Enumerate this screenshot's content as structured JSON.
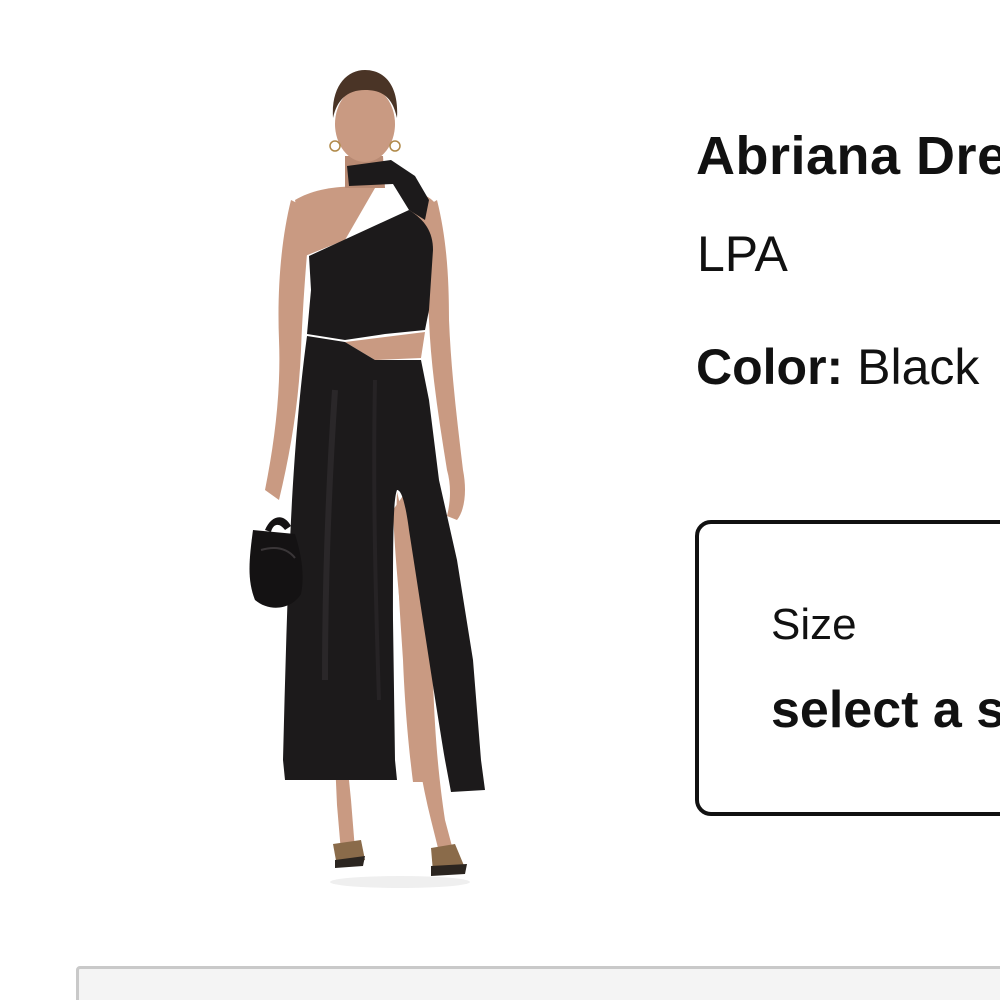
{
  "product": {
    "name": "Abriana Dress",
    "brand": "LPA",
    "color_label": "Color:",
    "color_value": "Black"
  },
  "size_selector": {
    "label": "Size",
    "value": "select a size"
  },
  "image": {
    "alt": "Model wearing black one-shoulder cut-out maxi dress with high slit, holding a black satin pouch bag"
  },
  "colors": {
    "dress": "#1c1a1b",
    "skin": "#c99a82",
    "hair": "#4a3426",
    "border": "#111111"
  }
}
